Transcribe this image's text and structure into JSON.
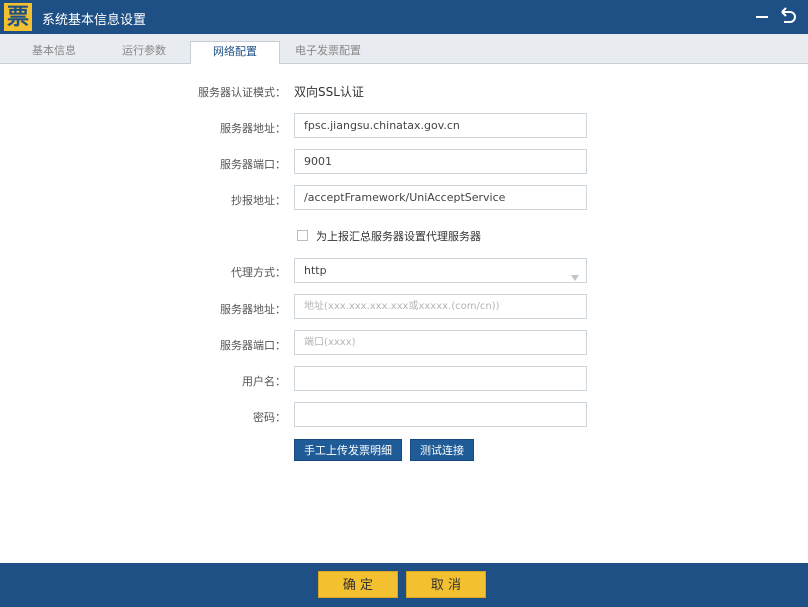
{
  "window": {
    "logo_text": "票",
    "title": "系统基本信息设置"
  },
  "tabs": [
    "基本信息",
    "运行参数",
    "网络配置",
    "电子发票配置"
  ],
  "active_tab": "网络配置",
  "form": {
    "auth_mode_label": "服务器认证模式：",
    "auth_mode_value": "双向SSL认证",
    "server_address_label": "服务器地址：",
    "server_address_value": "fpsc.jiangsu.chinatax.gov.cn",
    "server_port_label": "服务器端口：",
    "server_port_value": "9001",
    "report_address_label": "抄报地址：",
    "report_address_value": "/acceptFramework/UniAcceptService",
    "proxy_checkbox_label": "为上报汇总服务器设置代理服务器",
    "proxy_checkbox_checked": false,
    "proxy_mode_label": "代理方式：",
    "proxy_mode_value": "http",
    "proxy_address_label": "服务器地址：",
    "proxy_address_placeholder": "地址(xxx.xxx.xxx.xxx或xxxxx.(com/cn))",
    "proxy_port_label": "服务器端口：",
    "proxy_port_placeholder": "端口(xxxx)",
    "username_label": "用户名：",
    "username_value": "",
    "password_label": "密码：",
    "password_value": ""
  },
  "actions": {
    "upload_detail": "手工上传发票明细",
    "test_connection": "测试连接"
  },
  "footer": {
    "confirm": "确 定",
    "cancel": "取 消"
  },
  "colors": {
    "header": "#1e4f85",
    "accent_button": "#1e5b97",
    "footer_button": "#f3c02f"
  },
  "icons": {
    "minimize": "minimize-icon",
    "back": "back-arrow-icon",
    "select": "chevron-down-icon"
  }
}
